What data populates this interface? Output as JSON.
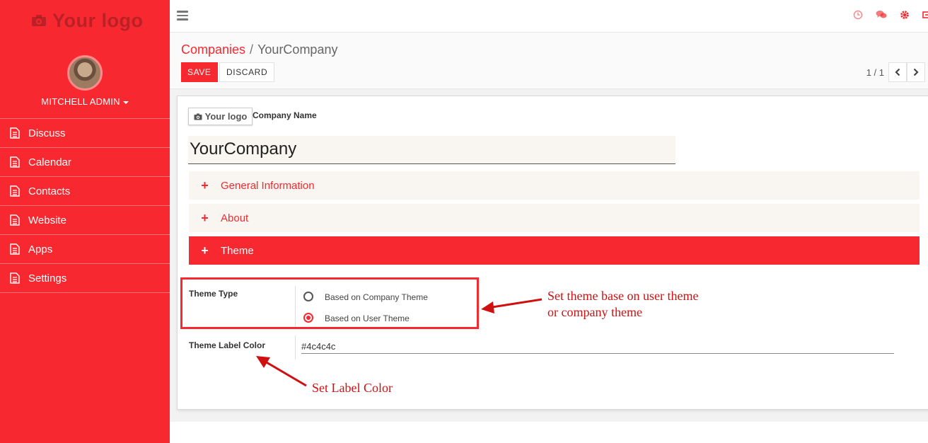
{
  "sidebar": {
    "logo_text": "Your logo",
    "user_name": "MITCHELL ADMIN",
    "items": [
      {
        "label": "Discuss"
      },
      {
        "label": "Calendar"
      },
      {
        "label": "Contacts"
      },
      {
        "label": "Website"
      },
      {
        "label": "Apps"
      },
      {
        "label": "Settings"
      }
    ]
  },
  "breadcrumb": {
    "parent": "Companies",
    "separator": "/",
    "current": "YourCompany"
  },
  "toolbar": {
    "save_label": "SAVE",
    "discard_label": "DISCARD",
    "pager": "1 / 1"
  },
  "form": {
    "logo_text": "Your logo",
    "company_name_label": "Company Name",
    "company_name_value": "YourCompany",
    "sections": [
      {
        "label": "General Information"
      },
      {
        "label": "About"
      },
      {
        "label": "Theme"
      }
    ],
    "theme_type_label": "Theme Type",
    "theme_options": [
      {
        "label": "Based on Company Theme",
        "checked": false
      },
      {
        "label": "Based on User Theme",
        "checked": true
      }
    ],
    "theme_label_color_label": "Theme Label Color",
    "theme_label_color_value": "#4c4c4c"
  },
  "annotations": {
    "theme_note_line1": "Set theme base on user theme",
    "theme_note_line2": "or company theme",
    "label_color_note": "Set Label Color"
  },
  "colors": {
    "accent": "#f7282f",
    "annotation": "#d01010",
    "section_bg": "#f9f5f0"
  }
}
